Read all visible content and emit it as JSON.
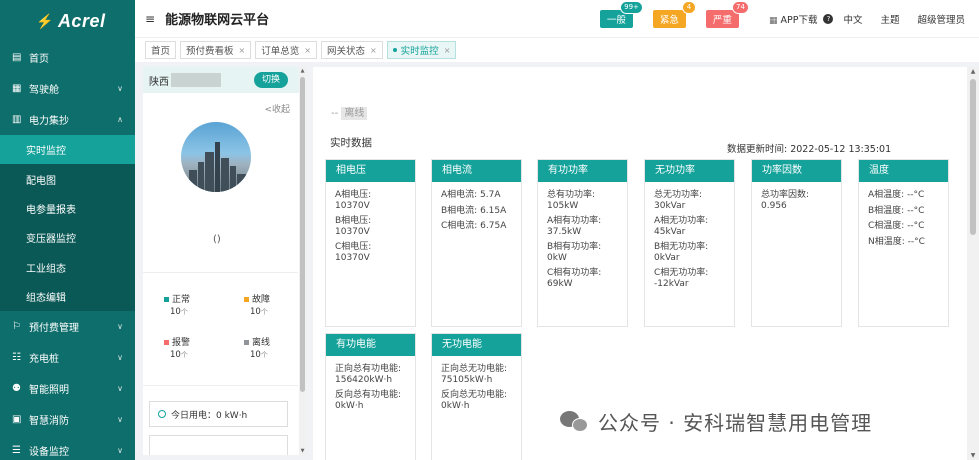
{
  "brand": {
    "logo_mark": "⚡",
    "logo_text": "Acrel"
  },
  "sidebar": {
    "items": [
      {
        "icon": "▤",
        "label": "首页",
        "chevron": ""
      },
      {
        "icon": "▦",
        "label": "驾驶舱",
        "chevron": "∨"
      },
      {
        "icon": "▥",
        "label": "电力集抄",
        "chevron": "∧"
      }
    ],
    "sub_items": [
      "实时监控",
      "配电图",
      "电参量报表",
      "变压器监控",
      "工业组态",
      "组态编辑"
    ],
    "items_after": [
      {
        "icon": "⚐",
        "label": "预付费管理",
        "chevron": "∨"
      },
      {
        "icon": "☷",
        "label": "充电桩",
        "chevron": "∨"
      },
      {
        "icon": "⚉",
        "label": "智能照明",
        "chevron": "∨"
      },
      {
        "icon": "▣",
        "label": "智慧消防",
        "chevron": "∨"
      },
      {
        "icon": "☰",
        "label": "设备监控",
        "chevron": "∨"
      }
    ]
  },
  "header": {
    "menu_icon": "≡",
    "title": "能源物联网云平台",
    "alerts": [
      {
        "label": "一般",
        "count": "99+"
      },
      {
        "label": "紧急",
        "count": "4"
      },
      {
        "label": "严重",
        "count": "74"
      }
    ],
    "app_download": "APP下载",
    "help": "?",
    "language": "中文",
    "theme": "主题",
    "user": "超级管理员"
  },
  "tabs": [
    {
      "label": "首页",
      "closable": false
    },
    {
      "label": "预付费看板",
      "closable": true
    },
    {
      "label": "订单总览",
      "closable": true
    },
    {
      "label": "网关状态",
      "closable": true
    },
    {
      "label": "实时监控",
      "closable": true
    }
  ],
  "station": {
    "name_prefix": "陕西",
    "switch_label": "切换",
    "collapse_label": "<收起",
    "name_paren": "()"
  },
  "status_legend": [
    {
      "label": "正常",
      "count": "10",
      "unit": "个",
      "color": "#14a29a"
    },
    {
      "label": "故障",
      "count": "10",
      "unit": "个",
      "color": "#f5a623"
    },
    {
      "label": "报警",
      "count": "10",
      "unit": "个",
      "color": "#f56c6c"
    },
    {
      "label": "离线",
      "count": "10",
      "unit": "个",
      "color": "#909399"
    }
  ],
  "today_power": "今日用电：0 kW·h",
  "main": {
    "offline_prefix": "--",
    "offline_tag": "离线",
    "realtime_title": "实时数据",
    "update_time": "数据更新时间: 2022-05-12 13:35:01",
    "cards": [
      {
        "title": "相电压",
        "rows": [
          "A相电压: 10370V",
          "B相电压: 10370V",
          "C相电压: 10370V"
        ]
      },
      {
        "title": "相电流",
        "rows": [
          "A相电流: 5.7A",
          "B相电流: 6.15A",
          "C相电流: 6.75A"
        ]
      },
      {
        "title": "有功功率",
        "rows": [
          "总有功功率: 105kW",
          "A相有功功率: 37.5kW",
          "B相有功功率: 0kW",
          "C相有功功率: 69kW"
        ]
      },
      {
        "title": "无功功率",
        "rows": [
          "总无功功率: 30kVar",
          "A相无功功率: 45kVar",
          "B相无功功率: 0kVar",
          "C相无功功率: -12kVar"
        ]
      },
      {
        "title": "功率因数",
        "rows": [
          "总功率因数: 0.956"
        ]
      },
      {
        "title": "温度",
        "rows": [
          "A相温度: --°C",
          "B相温度: --°C",
          "C相温度: --°C",
          "N相温度: --°C"
        ]
      },
      {
        "title": "有功电能",
        "rows": [
          "正向总有功电能: 156420kW·h",
          "反向总有功电能: 0kW·h"
        ]
      },
      {
        "title": "无功电能",
        "rows": [
          "正向总无功电能: 75105kW·h",
          "反向总无功电能: 0kW·h"
        ]
      }
    ]
  },
  "watermark": "公众号 · 安科瑞智慧用电管理",
  "colors": {
    "primary": "#14a29a",
    "sidebar": "#0e6e6b",
    "warning": "#f5a623",
    "danger": "#f56c6c"
  }
}
